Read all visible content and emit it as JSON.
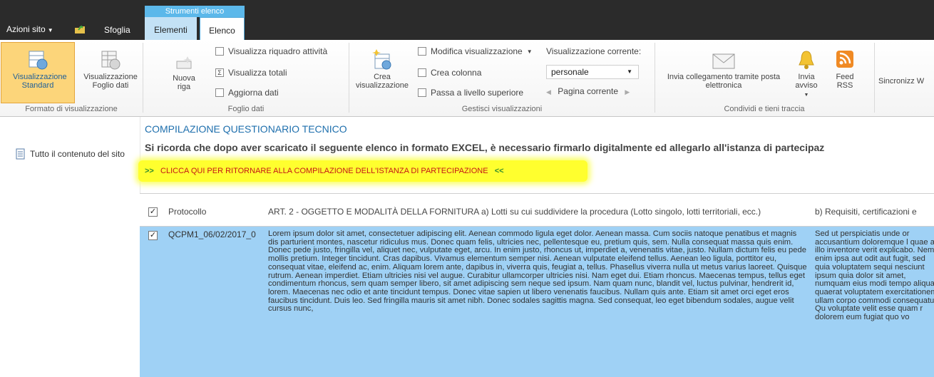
{
  "top": {
    "context_group": "Strumenti elenco",
    "site_actions": "Azioni sito",
    "tab_browse": "Sfoglia",
    "tab_items": "Elementi",
    "tab_list": "Elenco"
  },
  "ribbon": {
    "format": {
      "standard_view": "Visualizzazione Standard",
      "datasheet_view": "Visualizzazione Foglio dati",
      "label": "Formato di visualizzazione"
    },
    "datasheet": {
      "new_row": "Nuova riga",
      "task_pane": "Visualizza riquadro attività",
      "totals": "Visualizza totali",
      "refresh": "Aggiorna dati",
      "label": "Foglio dati"
    },
    "views": {
      "create_view": "Crea visualizzazione",
      "modify_view": "Modifica visualizzazione",
      "create_column": "Crea colonna",
      "navigate_up": "Passa a livello superiore",
      "current_view_label": "Visualizzazione corrente:",
      "current_view_value": "personale",
      "current_page": "Pagina corrente",
      "label": "Gestisci visualizzazioni"
    },
    "share": {
      "email_link": "Invia collegamento tramite posta elettronica",
      "alert": "Invia avviso",
      "rss": "Feed RSS",
      "label": "Condividi e tieni traccia",
      "sync": "Sincronizz W"
    }
  },
  "leftnav": {
    "all_content": "Tutto il contenuto del sito"
  },
  "content": {
    "title": "COMPILAZIONE QUESTIONARIO TECNICO",
    "notice": "Si ricorda che dopo aver scaricato il seguente elenco in formato EXCEL, è necessario firmarlo digitalmente ed allegarlo all'istanza di partecipaz",
    "back_link": "CLICCA QUI PER RITORNARE ALLA COMPILAZIONE DELL'ISTANZA DI PARTECIPAZIONE",
    "arrow_left": ">>",
    "arrow_right": "<<"
  },
  "table": {
    "headers": [
      "Protocollo",
      "ART. 2 - OGGETTO E MODALITÀ DELLA FORNITURA a) Lotti su cui suddividere la procedura (Lotto singolo, lotti territoriali, ecc.)",
      "b) Requisiti, certificazioni e"
    ],
    "rows": [
      {
        "protocol": "QCPM1_06/02/2017_0",
        "col2": "Lorem ipsum dolor sit amet, consectetuer adipiscing elit. Aenean commodo ligula eget dolor. Aenean massa. Cum sociis natoque penatibus et magnis dis parturient montes, nascetur ridiculus mus. Donec quam felis, ultricies nec, pellentesque eu, pretium quis, sem. Nulla consequat massa quis enim. Donec pede justo, fringilla vel, aliquet nec, vulputate eget, arcu. In enim justo, rhoncus ut, imperdiet a, venenatis vitae, justo. Nullam dictum felis eu pede mollis pretium. Integer tincidunt. Cras dapibus. Vivamus elementum semper nisi. Aenean vulputate eleifend tellus. Aenean leo ligula, porttitor eu, consequat vitae, eleifend ac, enim. Aliquam lorem ante, dapibus in, viverra quis, feugiat a, tellus. Phasellus viverra nulla ut metus varius laoreet. Quisque rutrum. Aenean imperdiet. Etiam ultricies nisi vel augue. Curabitur ullamcorper ultricies nisi. Nam eget dui. Etiam rhoncus. Maecenas tempus, tellus eget condimentum rhoncus, sem quam semper libero, sit amet adipiscing sem neque sed ipsum. Nam quam nunc, blandit vel, luctus pulvinar, hendrerit id, lorem. Maecenas nec odio et ante tincidunt tempus. Donec vitae sapien ut libero venenatis faucibus. Nullam quis ante. Etiam sit amet orci eget eros faucibus tincidunt. Duis leo. Sed fringilla mauris sit amet nibh. Donec sodales sagittis magna. Sed consequat, leo eget bibendum sodales, augue velit cursus nunc,",
        "col3": "Sed ut perspiciatis unde or accusantium doloremque l quae ab illo inventore verit explicabo. Nemo enim ipsa aut odit aut fugit, sed quia voluptatem sequi nesciunt ipsum quia dolor sit amet, numquam eius modi tempo aliquam quaerat voluptatem exercitationem ullam corpo commodi consequatur? Qu voluptate velit esse quam r dolorem eum fugiat quo vo"
      }
    ]
  },
  "colors": {
    "accent": "#1e6fad",
    "row_selected": "#9fd1f5",
    "highlight": "#ffff2e",
    "link_red": "#c41616",
    "context_tab": "#5cb8ea"
  }
}
